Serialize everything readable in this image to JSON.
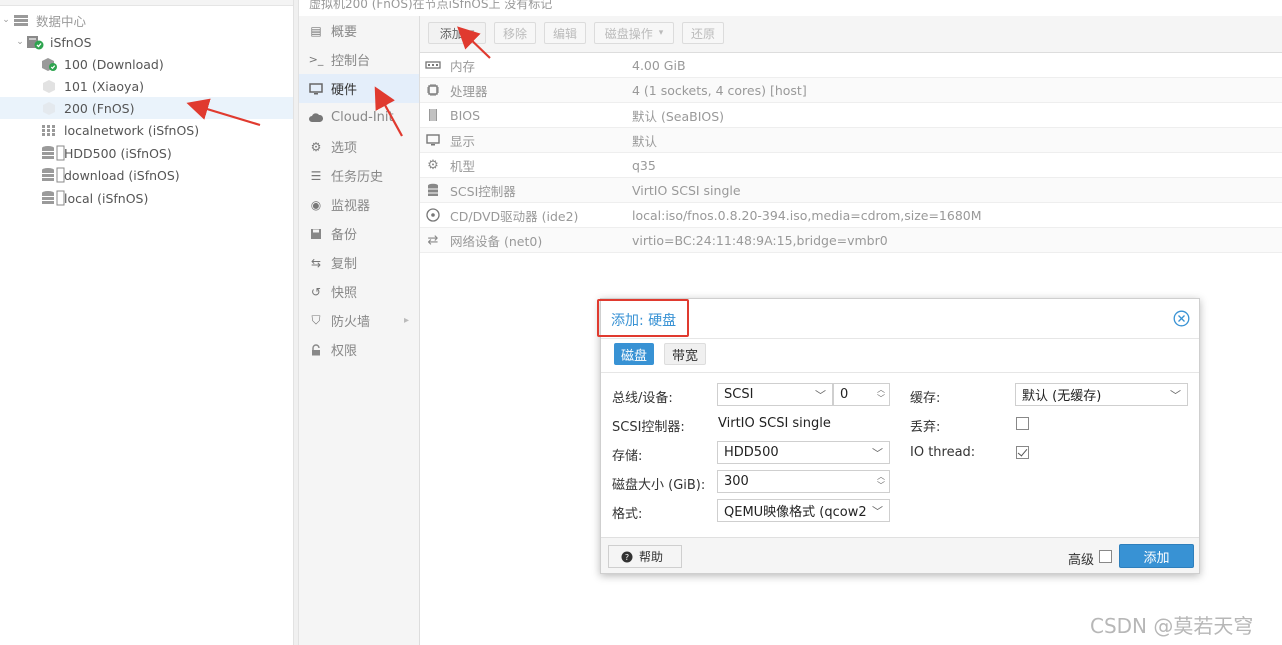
{
  "topline": "虚拟机200 (FnOS)在节点iSfnOS上    没有标记",
  "tree": {
    "datacenter": "数据中心",
    "node": "iSfnOS",
    "vms": [
      "100 (Download)",
      "101 (Xiaoya)",
      "200 (FnOS)"
    ],
    "storage": [
      "localnetwork (iSfnOS)",
      "HDD500 (iSfnOS)",
      "download (iSfnOS)",
      "local (iSfnOS)"
    ]
  },
  "menu": {
    "items": [
      "概要",
      "控制台",
      "硬件",
      "Cloud-Init",
      "选项",
      "任务历史",
      "监视器",
      "备份",
      "复制",
      "快照",
      "防火墙",
      "权限"
    ],
    "active": "硬件"
  },
  "toolbar": {
    "add": "添加",
    "remove": "移除",
    "edit": "编辑",
    "disk_action": "磁盘操作",
    "revert": "还原"
  },
  "hardware": {
    "rows": [
      {
        "name": "内存",
        "value": "4.00 GiB",
        "icon": "memory-icon"
      },
      {
        "name": "处理器",
        "value": "4 (1 sockets, 4 cores) [host]",
        "icon": "cpu-icon"
      },
      {
        "name": "BIOS",
        "value": "默认 (SeaBIOS)",
        "icon": "bios-icon"
      },
      {
        "name": "显示",
        "value": "默认",
        "icon": "display-icon"
      },
      {
        "name": "机型",
        "value": "q35",
        "icon": "machine-icon"
      },
      {
        "name": "SCSI控制器",
        "value": "VirtIO SCSI single",
        "icon": "database-icon"
      },
      {
        "name": "CD/DVD驱动器 (ide2)",
        "value": "local:iso/fnos.0.8.20-394.iso,media=cdrom,size=1680M",
        "icon": "cdrom-icon"
      },
      {
        "name": "网络设备 (net0)",
        "value": "virtio=BC:24:11:48:9A:15,bridge=vmbr0",
        "icon": "network-icon"
      }
    ]
  },
  "dialog": {
    "title": "添加: 硬盘",
    "tabs": [
      "磁盘",
      "带宽"
    ],
    "labels": {
      "bus": "总线/设备:",
      "scsi_ctrl": "SCSI控制器:",
      "storage": "存储:",
      "size": "磁盘大小 (GiB):",
      "format": "格式:",
      "cache": "缓存:",
      "discard": "丢弃:",
      "io_thread": "IO thread:"
    },
    "values": {
      "bus": "SCSI",
      "device": "0",
      "scsi_ctrl": "VirtIO SCSI single",
      "storage": "HDD500",
      "size": "300",
      "format": "QEMU映像格式 (qcow2",
      "cache": "默认 (无缓存)",
      "discard_checked": false,
      "io_thread_checked": true
    },
    "help": "帮助",
    "advanced": "高级",
    "add": "添加"
  },
  "watermark": "CSDN @莫若天穹",
  "colors": {
    "accent": "#3892d4",
    "annotation_red": "#e03a2f"
  }
}
